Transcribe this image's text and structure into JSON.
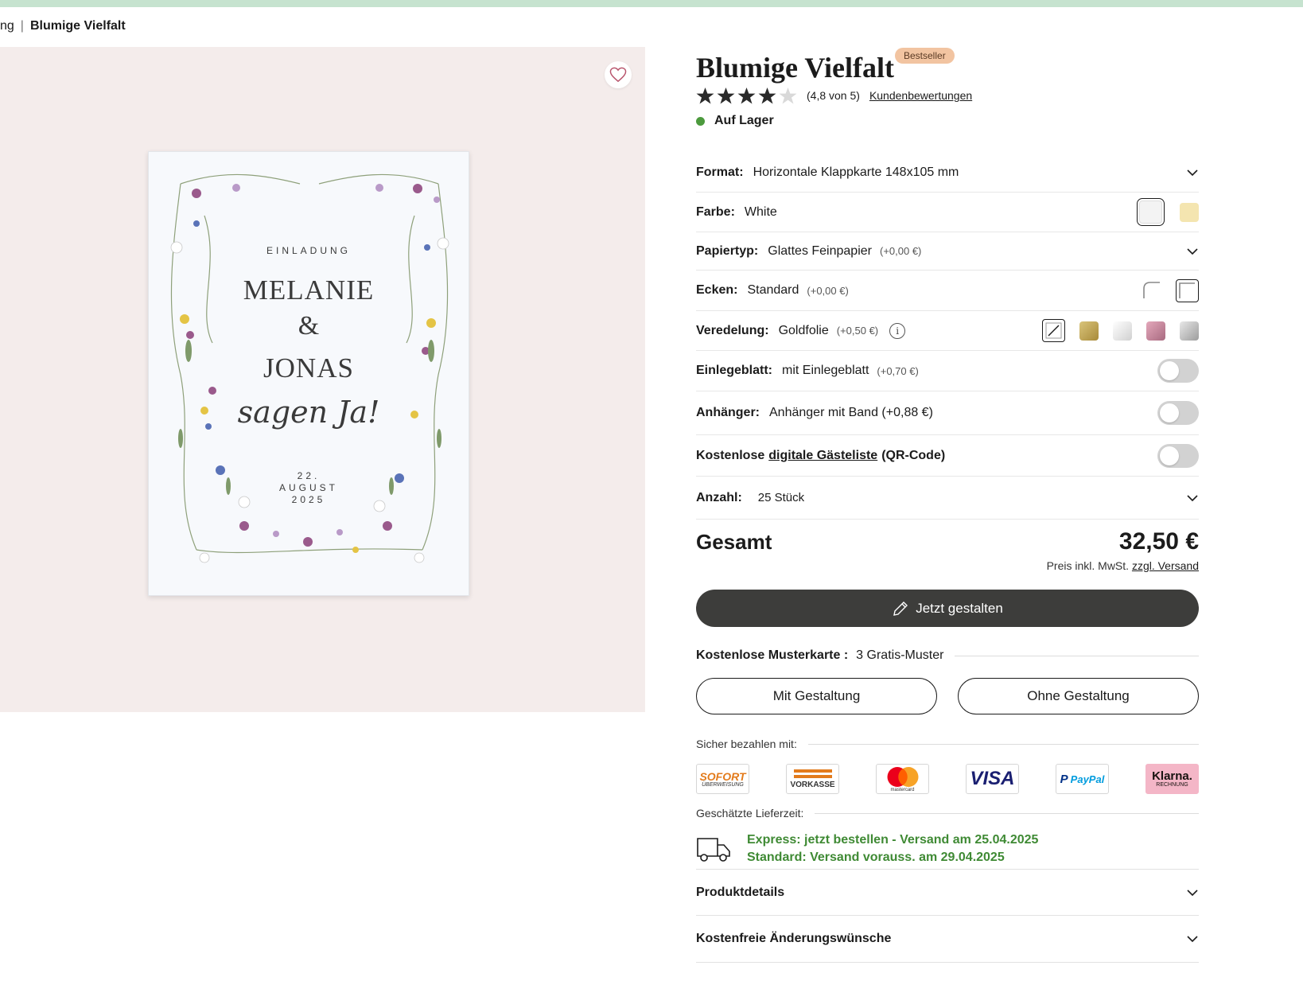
{
  "breadcrumb": {
    "prev": "ng",
    "separator": "|",
    "current": "Blumige Vielfalt"
  },
  "card": {
    "einladung": "EINLADUNG",
    "name1": "MELANIE",
    "amp": "&",
    "name2": "JONAS",
    "script": "sagen Ja!",
    "date_day": "22.",
    "date_month": "AUGUST",
    "date_year": "2025"
  },
  "product": {
    "title": "Blumige Vielfalt",
    "badge": "Bestseller",
    "rating_value": 4.8,
    "rating_text": "(4,8 von 5)",
    "reviews_link": "Kundenbewertungen",
    "stock": "Auf Lager"
  },
  "options": {
    "format": {
      "label": "Format:",
      "value": "Horizontale Klappkarte 148x105 mm"
    },
    "farbe": {
      "label": "Farbe:",
      "value": "White",
      "swatches": [
        "#f3f3f3",
        "#f4e5b0"
      ]
    },
    "papier": {
      "label": "Papiertyp:",
      "value": "Glattes Feinpapier",
      "extra": "(+0,00 €)"
    },
    "ecken": {
      "label": "Ecken:",
      "value": "Standard",
      "extra": "(+0,00 €)"
    },
    "veredelung": {
      "label": "Veredelung:",
      "value": "Goldfolie",
      "extra": "(+0,50 €)",
      "info": "i"
    },
    "einlegeblatt": {
      "label": "Einlegeblatt:",
      "value": "mit Einlegeblatt",
      "extra": "(+0,70 €)"
    },
    "anhaenger": {
      "label": "Anhänger:",
      "value": "Anhänger mit Band (+0,88 €)"
    },
    "gaesteliste": {
      "prefix": "Kostenlose",
      "link": "digitale Gästeliste",
      "suffix": "(QR-Code)"
    },
    "anzahl": {
      "label": "Anzahl:",
      "value": "25 Stück"
    }
  },
  "total": {
    "label": "Gesamt",
    "price": "32,50 €",
    "tax_prefix": "Preis inkl. MwSt.",
    "tax_link": "zzgl. Versand"
  },
  "cta": {
    "label": "Jetzt gestalten"
  },
  "samples": {
    "label": "Kostenlose Musterkarte :",
    "value": "3 Gratis-Muster",
    "btn_with": "Mit Gestaltung",
    "btn_without": "Ohne Gestaltung"
  },
  "payment": {
    "label": "Sicher bezahlen mit:",
    "sofort_1": "SOFORT",
    "sofort_2": "ÜBERWEISUNG",
    "vorkasse": "VORKASSE",
    "mastercard": "mastercard",
    "visa": "VISA",
    "paypal": "PayPal",
    "klarna_1": "Klarna.",
    "klarna_2": "RECHNUNG"
  },
  "delivery": {
    "label": "Geschätzte Lieferzeit:",
    "express": "Express: jetzt bestellen - Versand am 25.04.2025",
    "standard": "Standard: Versand vorauss. am 29.04.2025"
  },
  "accordions": {
    "details": "Produktdetails",
    "changes": "Kostenfreie Änderungswünsche"
  },
  "colors": {
    "accent_green": "#3f8a34",
    "cta_dark": "#3d3d3b",
    "gallery_bg": "#f4eceb",
    "top_bar": "#c6e3cf"
  }
}
